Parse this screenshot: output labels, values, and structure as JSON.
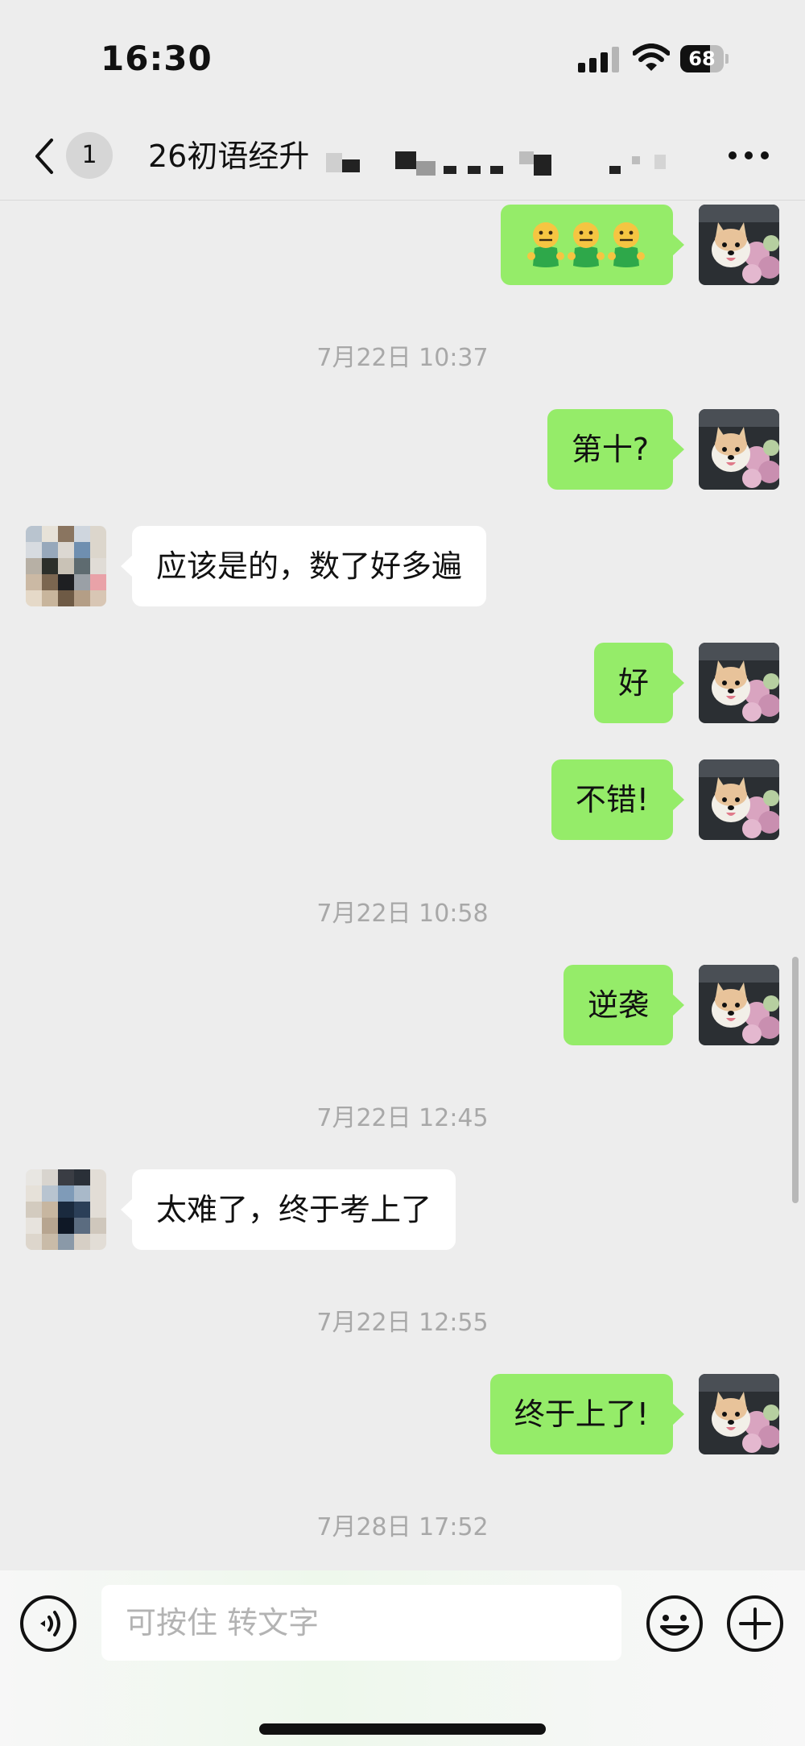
{
  "status_bar": {
    "time": "16:30",
    "battery": "68",
    "battery_level_percent": 68
  },
  "nav": {
    "unread_count": "1",
    "title": "26初语经升"
  },
  "messages": [
    {
      "id": "m0",
      "type": "emoji",
      "sender": "me",
      "emoji_icons": [
        "zipper-mouth-face-icon",
        "zipper-mouth-face-icon",
        "zipper-mouth-face-icon"
      ]
    },
    {
      "id": "t1",
      "type": "time",
      "text": "7月22日 10:37"
    },
    {
      "id": "m1",
      "type": "text",
      "sender": "me",
      "text": "第十?"
    },
    {
      "id": "m2",
      "type": "text",
      "sender": "other",
      "text": "应该是的，数了好多遍"
    },
    {
      "id": "m3",
      "type": "text",
      "sender": "me",
      "text": "好"
    },
    {
      "id": "m4",
      "type": "text",
      "sender": "me",
      "text": "不错!"
    },
    {
      "id": "t2",
      "type": "time",
      "text": "7月22日 10:58"
    },
    {
      "id": "m5",
      "type": "text",
      "sender": "me",
      "text": "逆袭"
    },
    {
      "id": "t3",
      "type": "time",
      "text": "7月22日 12:45"
    },
    {
      "id": "m6",
      "type": "text",
      "sender": "other",
      "text": "太难了，终于考上了"
    },
    {
      "id": "t4",
      "type": "time",
      "text": "7月22日 12:55"
    },
    {
      "id": "m7",
      "type": "text",
      "sender": "me",
      "text": "终于上了!"
    },
    {
      "id": "t5",
      "type": "time",
      "text": "7月28日 17:52"
    }
  ],
  "input_bar": {
    "placeholder": "可按住 转文字"
  },
  "colors": {
    "background": "#ededed",
    "my_bubble": "#95ec69",
    "their_bubble": "#ffffff",
    "timestamp": "#a8a8a8"
  }
}
